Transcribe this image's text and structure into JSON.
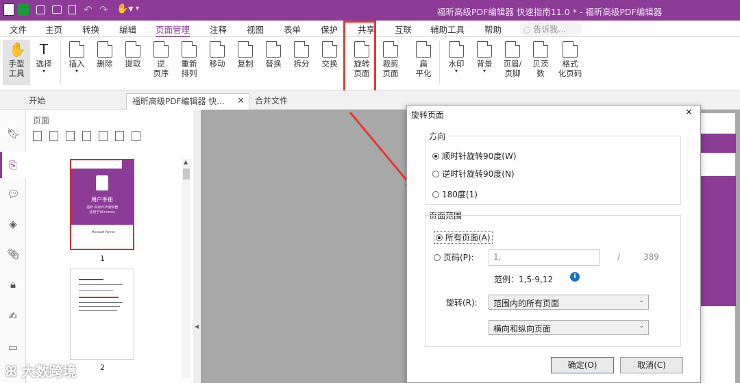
{
  "titlebar": {
    "title": "福昕高级PDF编辑器 快速指南11.0 * - 福昕高级PDF编辑器"
  },
  "menu": [
    "文件",
    "主页",
    "转换",
    "编辑",
    "页面管理",
    "注释",
    "视图",
    "表单",
    "保护",
    "共享",
    "互联",
    "辅助工具",
    "帮助"
  ],
  "search_placeholder": "告诉我...",
  "tools": [
    {
      "label": "手型\n工具"
    },
    {
      "label": "选择"
    },
    {
      "label": "插入"
    },
    {
      "label": "删除"
    },
    {
      "label": "提取"
    },
    {
      "label": "逆\n页序"
    },
    {
      "label": "重新\n排列"
    },
    {
      "label": "移动"
    },
    {
      "label": "复制"
    },
    {
      "label": "替换"
    },
    {
      "label": "拆分"
    },
    {
      "label": "交换"
    },
    {
      "label": "旋转\n页面"
    },
    {
      "label": "裁剪\n页面"
    },
    {
      "label": "扁\n平化"
    },
    {
      "label": "水印"
    },
    {
      "label": "背景"
    },
    {
      "label": "页眉/\n页脚"
    },
    {
      "label": "贝茨\n数"
    },
    {
      "label": "格式\n化页码"
    }
  ],
  "tabs": [
    {
      "label": "开始"
    },
    {
      "label": "福昕高级PDF编辑器 快..."
    },
    {
      "label": "合并文件"
    }
  ],
  "thumb_panel": {
    "title": "页面",
    "page1_label": "1",
    "page2_label": "2",
    "cover_title": "用户手册",
    "cover_sub": "福昕 高级PDF编辑器",
    "cover_sub2": "适用于Windows",
    "brand": "Microsoft Partner"
  },
  "dialog": {
    "title": "旋转页面",
    "direction_label": "方向",
    "cw": "顺时针旋转90度(W)",
    "ccw": "逆时针旋转90度(N)",
    "r180": "180度(1)",
    "range_label": "页面范围",
    "all_pages": "所有页面(A)",
    "page_num": "页码(P):",
    "page_input": "1,",
    "slash": "/",
    "total": "389",
    "example": "范例：1,5-9,12",
    "rotate_label": "旋转(R):",
    "rotate_select": "范围内的所有页面",
    "orient_select": "横向和纵向页面",
    "ok": "确定(O)",
    "cancel": "取消(C)"
  },
  "watermark": "大数跨境"
}
